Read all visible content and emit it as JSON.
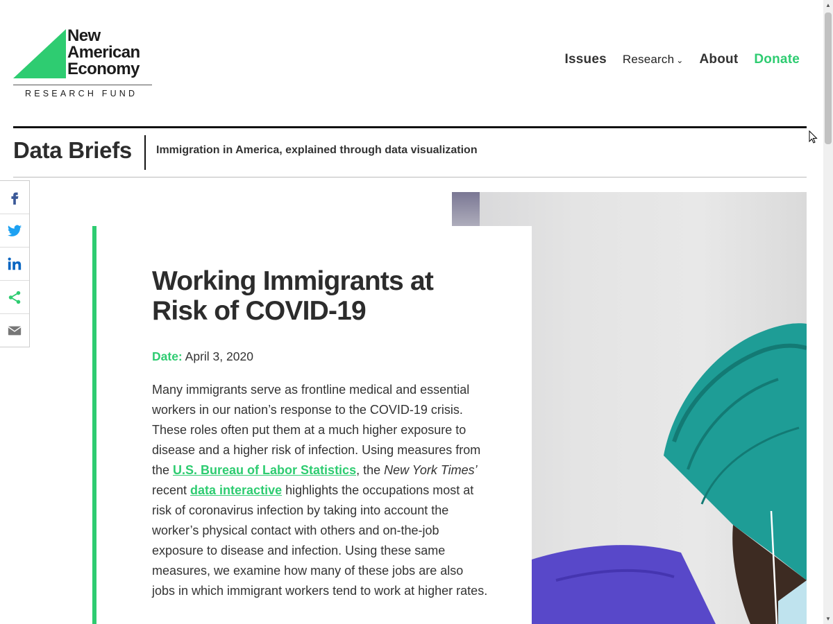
{
  "brand": {
    "name_line1": "New",
    "name_line2": "American",
    "name_line3": "Economy",
    "fund": "RESEARCH FUND",
    "accent": "#2ecc71"
  },
  "nav": {
    "issues": "Issues",
    "research": "Research",
    "about": "About",
    "donate": "Donate"
  },
  "section": {
    "title": "Data Briefs",
    "subtitle": "Immigration in America, explained through data visualization"
  },
  "share": [
    "facebook-icon",
    "twitter-icon",
    "linkedin-icon",
    "share-icon",
    "email-icon"
  ],
  "article": {
    "headline": "Working Immigrants at Risk of COVID-19",
    "date_label": "Date:",
    "date": "April 3, 2020",
    "p1_a": "Many immigrants serve as frontline medical and essential workers in our nation’s response to the COVID-19 crisis. These roles often put them at a much higher exposure to disease and a higher risk of infection. Using measures from the ",
    "link_bls": "U.S. Bureau of Labor Statistics",
    "p1_b": ", the ",
    "nyt": "New York Times’",
    "p1_c": " recent ",
    "link_interactive": "data interactive",
    "p1_d": " highlights the occupations most at risk of coronavirus infection by taking into account the worker’s physical contact with others and on-the-job exposure to disease and infection. Using these same measures, we examine how many of these jobs are also jobs in which immigrant workers tend to work at higher rates."
  }
}
